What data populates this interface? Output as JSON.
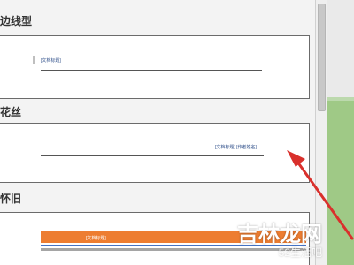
{
  "sections": [
    {
      "title": "边线型",
      "card_text": "[文档标题]"
    },
    {
      "title": "花丝",
      "card_text": "[文档标题] [作者姓名]"
    },
    {
      "title": "怀旧",
      "card_text": "[文档标题]"
    }
  ],
  "watermark": {
    "main": "吉林龙网",
    "sub": "52生活吧"
  },
  "colors": {
    "orange": "#ed7d31",
    "blue": "#4472c4",
    "arrow": "#d9302c"
  }
}
